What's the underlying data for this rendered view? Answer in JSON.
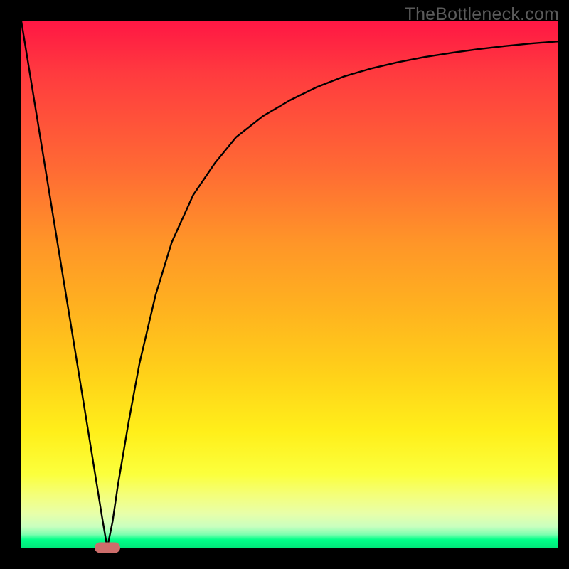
{
  "watermark": "TheBottleneck.com",
  "colors": {
    "frame": "#000000",
    "gradient_top": "#ff1744",
    "gradient_bottom": "#00e87a",
    "curve": "#000000",
    "marker": "#cd6d6b"
  },
  "chart_data": {
    "type": "line",
    "title": "",
    "xlabel": "",
    "ylabel": "",
    "xlim": [
      0,
      100
    ],
    "ylim": [
      0,
      100
    ],
    "grid": false,
    "legend": false,
    "series": [
      {
        "name": "bottleneck-curve",
        "x": [
          0,
          4,
          8,
          12,
          15,
          16,
          17,
          18,
          20,
          22,
          25,
          28,
          32,
          36,
          40,
          45,
          50,
          55,
          60,
          65,
          70,
          75,
          80,
          85,
          90,
          95,
          100
        ],
        "values": [
          100,
          75,
          50,
          25,
          6,
          0,
          5,
          12,
          24,
          35,
          48,
          58,
          67,
          73,
          78,
          82,
          85,
          87.5,
          89.5,
          91,
          92.2,
          93.2,
          94,
          94.7,
          95.3,
          95.8,
          96.2
        ]
      }
    ],
    "marker": {
      "x": 16,
      "y": 0
    },
    "annotations": []
  }
}
